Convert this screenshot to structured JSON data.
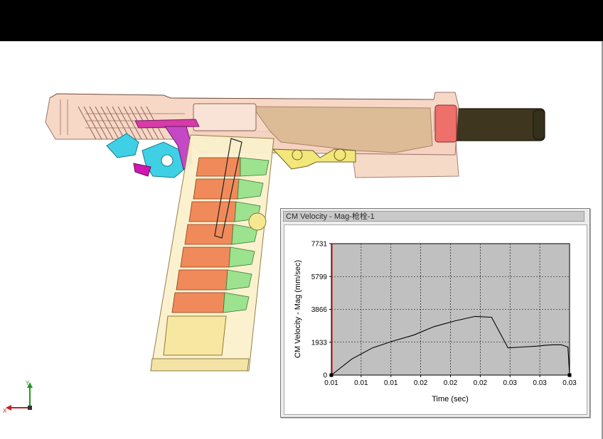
{
  "window": {
    "title": ""
  },
  "plot_window": {
    "title": "CM Velocity - Mag-枪栓-1"
  },
  "triad": {
    "x_label": "X",
    "y_label": "Y"
  },
  "chart_data": {
    "type": "line",
    "title": "",
    "xlabel": "Time (sec)",
    "ylabel": "CM Velocity - Mag (mm/sec)",
    "x_tick_labels": [
      "0.01",
      "0.01",
      "0.01",
      "0.02",
      "0.02",
      "0.02",
      "0.03",
      "0.03",
      "0.03"
    ],
    "y_tick_labels": [
      "0",
      "1933",
      "3866",
      "5799",
      "7731"
    ],
    "ylim": [
      0,
      7731
    ],
    "grid": true,
    "series": [
      {
        "x": [
          0.005,
          0.0075,
          0.01,
          0.0125,
          0.015,
          0.0175,
          0.02,
          0.0225,
          0.0245,
          0.0265,
          0.0282,
          0.03,
          0.031,
          0.032,
          0.033,
          0.0338,
          0.034
        ],
        "y": [
          0,
          950,
          1600,
          2000,
          2350,
          2850,
          3180,
          3450,
          3400,
          1600,
          1650,
          1700,
          1750,
          1780,
          1780,
          1650,
          0
        ]
      }
    ],
    "line_color": "#000000",
    "plot_bg": "#c0c0c0",
    "grid_color": "#000000"
  }
}
